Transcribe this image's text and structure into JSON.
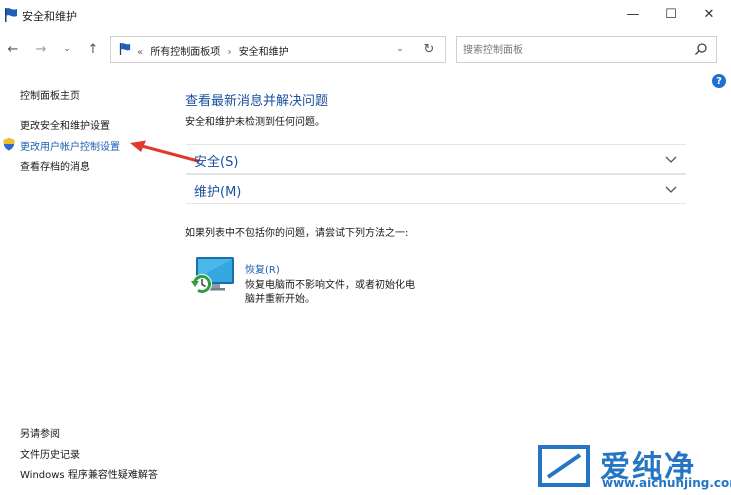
{
  "window": {
    "title": "安全和维护",
    "minimize_glyph": "—",
    "maximize_glyph": "☐",
    "close_glyph": "✕"
  },
  "nav": {
    "back_glyph": "←",
    "forward_glyph": "→",
    "recent_glyph": "⌄",
    "up_glyph": "↑"
  },
  "address": {
    "overflow": "«",
    "crumb1": "所有控制面板项",
    "separator": "›",
    "crumb2": "安全和维护",
    "dropdown_glyph": "⌄",
    "refresh_glyph": "↻"
  },
  "search": {
    "placeholder": "搜索控制面板"
  },
  "help": "?",
  "sidebar": {
    "home": "控制面板主页",
    "security_settings": "更改安全和维护设置",
    "uac_settings": "更改用户帐户控制设置",
    "archived_messages": "查看存档的消息",
    "see_also": "另请参阅",
    "file_history": "文件历史记录",
    "compat_troubleshooter": "Windows 程序兼容性疑难解答"
  },
  "main": {
    "title": "查看最新消息并解决问题",
    "subtitle": "安全和维护未检测到任何问题。",
    "sections": {
      "security": "安全(S)",
      "maintenance": "维护(M)"
    },
    "fix_hint": "如果列表中不包括你的问题，请尝试下列方法之一:",
    "recovery": {
      "link": "恢复(R)",
      "description": "恢复电脑而不影响文件，或者初始化电脑并重新开始。"
    }
  },
  "watermark": {
    "chinese": "爱纯净",
    "url": "www.aichunjing.com"
  },
  "colors": {
    "link_blue": "#1a5fb4",
    "heading_blue": "#1a4f9c",
    "arrow_red": "#e03a2e",
    "watermark_blue": "#2476c4"
  },
  "icons": {
    "title_flag": "flag-icon",
    "search": "search-icon",
    "uac": "shield-icon",
    "recovery": "recovery-icon",
    "chevron": "chevron-down-icon"
  }
}
